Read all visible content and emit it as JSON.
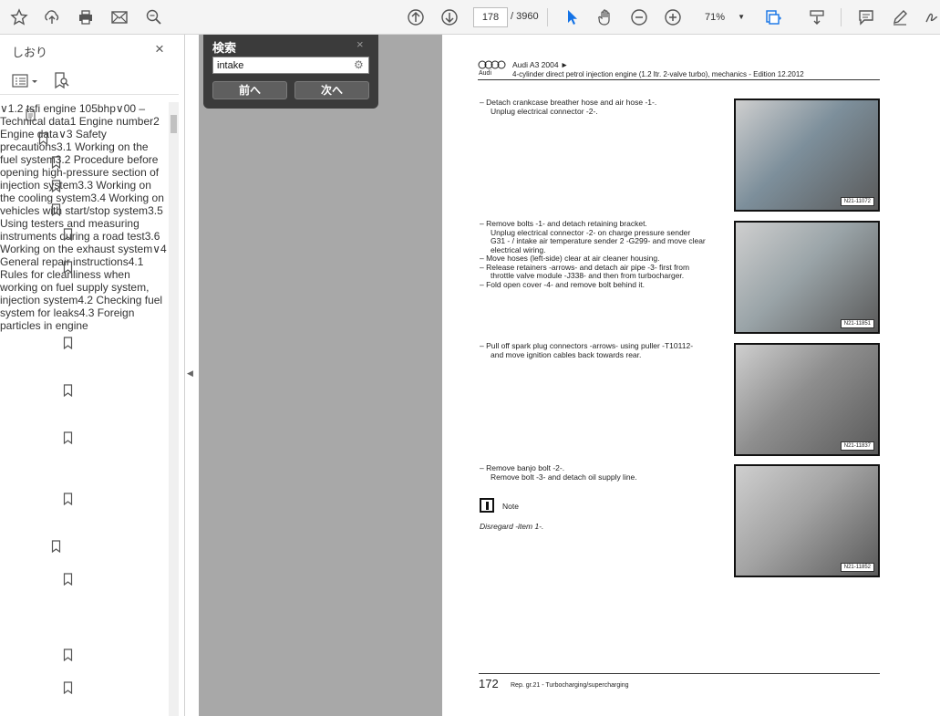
{
  "toolbar": {
    "page_current": "178",
    "page_total": "/  3960",
    "zoom": "71%"
  },
  "sidebar": {
    "title": "しおり",
    "close": "×",
    "tree": [
      {
        "label": "1.2 tsfi engine 105bhp"
      },
      {
        "label": "00 – Technical data"
      },
      {
        "label": "1 Engine number"
      },
      {
        "label": "2 Engine data"
      },
      {
        "label": "3 Safety precautions"
      },
      {
        "label": "3.1 Working on the fuel system"
      },
      {
        "label": "3.2 Procedure before opening high-pressure section of injection system"
      },
      {
        "label": "3.3 Working on the cooling system"
      },
      {
        "label": "3.4 Working on vehicles with start/stop system"
      },
      {
        "label": "3.5 Using testers and measuring instruments during a road test"
      },
      {
        "label": "3.6 Working on the exhaust system"
      },
      {
        "label": "4 General repair instructions"
      },
      {
        "label": "4.1 Rules for cleanliness when working on fuel supply system, injection system"
      },
      {
        "label": "4.2 Checking fuel system for leaks"
      },
      {
        "label": "4.3 Foreign particles in engine"
      }
    ]
  },
  "find": {
    "title": "検索",
    "close": "×",
    "query": "intake",
    "prev": "前へ",
    "next": "次へ"
  },
  "document": {
    "header_brand": "Audi",
    "header_model": "Audi A3 2004 ►",
    "header_sub": "4-cylinder direct petrol injection engine (1.2 ltr. 2-valve turbo), mechanics - Edition 12.2012",
    "steps": [
      {
        "lines": [
          "– Detach crankcase breather hose and air hose -1-.",
          "Unplug electrical connector -2-."
        ],
        "figure": "N21-11072"
      },
      {
        "lines": [
          "– Remove bolts -1- and detach retaining bracket.",
          "Unplug electrical connector -2- on charge pressure sender",
          "G31 - / intake air temperature sender 2 -G299- and move clear",
          "electrical wiring.",
          "– Move hoses (left-side) clear at air cleaner housing.",
          "– Release retainers -arrows- and detach air pipe -3- first from",
          "throttle valve module -J338- and then from turbocharger.",
          "– Fold open cover -4- and remove bolt behind it."
        ],
        "figure": "N21-11851"
      },
      {
        "lines": [
          "– Pull off spark plug connectors -arrows- using puller -T10112-",
          "and move ignition cables back towards rear."
        ],
        "figure": "N21-11837"
      },
      {
        "lines": [
          "– Remove banjo bolt -2-.",
          "Remove bolt -3- and detach oil supply line."
        ],
        "figure": "N21-11852"
      }
    ],
    "note_label": "Note",
    "note_text": "Disregard -item 1-.",
    "footer_page": "172",
    "footer_text": "Rep. gr.21 - Turbocharging/supercharging"
  }
}
